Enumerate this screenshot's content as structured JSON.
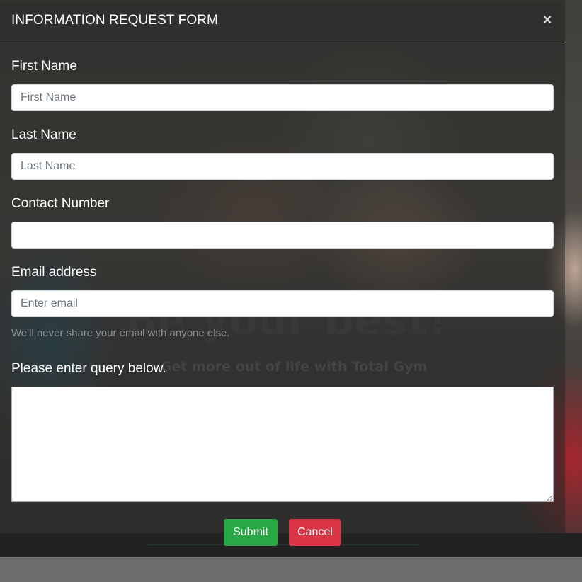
{
  "hero": {
    "headline": "Be your best!",
    "subheadline": "Get more out of life with Total Gym"
  },
  "modal": {
    "title": "INFORMATION REQUEST FORM",
    "close_symbol": "×",
    "close_icon": "close-icon"
  },
  "form": {
    "first_name": {
      "label": "First Name",
      "placeholder": "First Name",
      "value": ""
    },
    "last_name": {
      "label": "Last Name",
      "placeholder": "Last Name",
      "value": ""
    },
    "contact_number": {
      "label": "Contact Number",
      "placeholder": "",
      "value": ""
    },
    "email": {
      "label": "Email address",
      "placeholder": "Enter email",
      "value": "",
      "help": "We'll never share your email with anyone else."
    },
    "query": {
      "label": "Please enter query below.",
      "value": ""
    }
  },
  "buttons": {
    "submit_label": "Submit",
    "cancel_label": "Cancel"
  },
  "colors": {
    "submit": "#28a745",
    "cancel": "#dc3545",
    "title_text": "#ffffff"
  }
}
